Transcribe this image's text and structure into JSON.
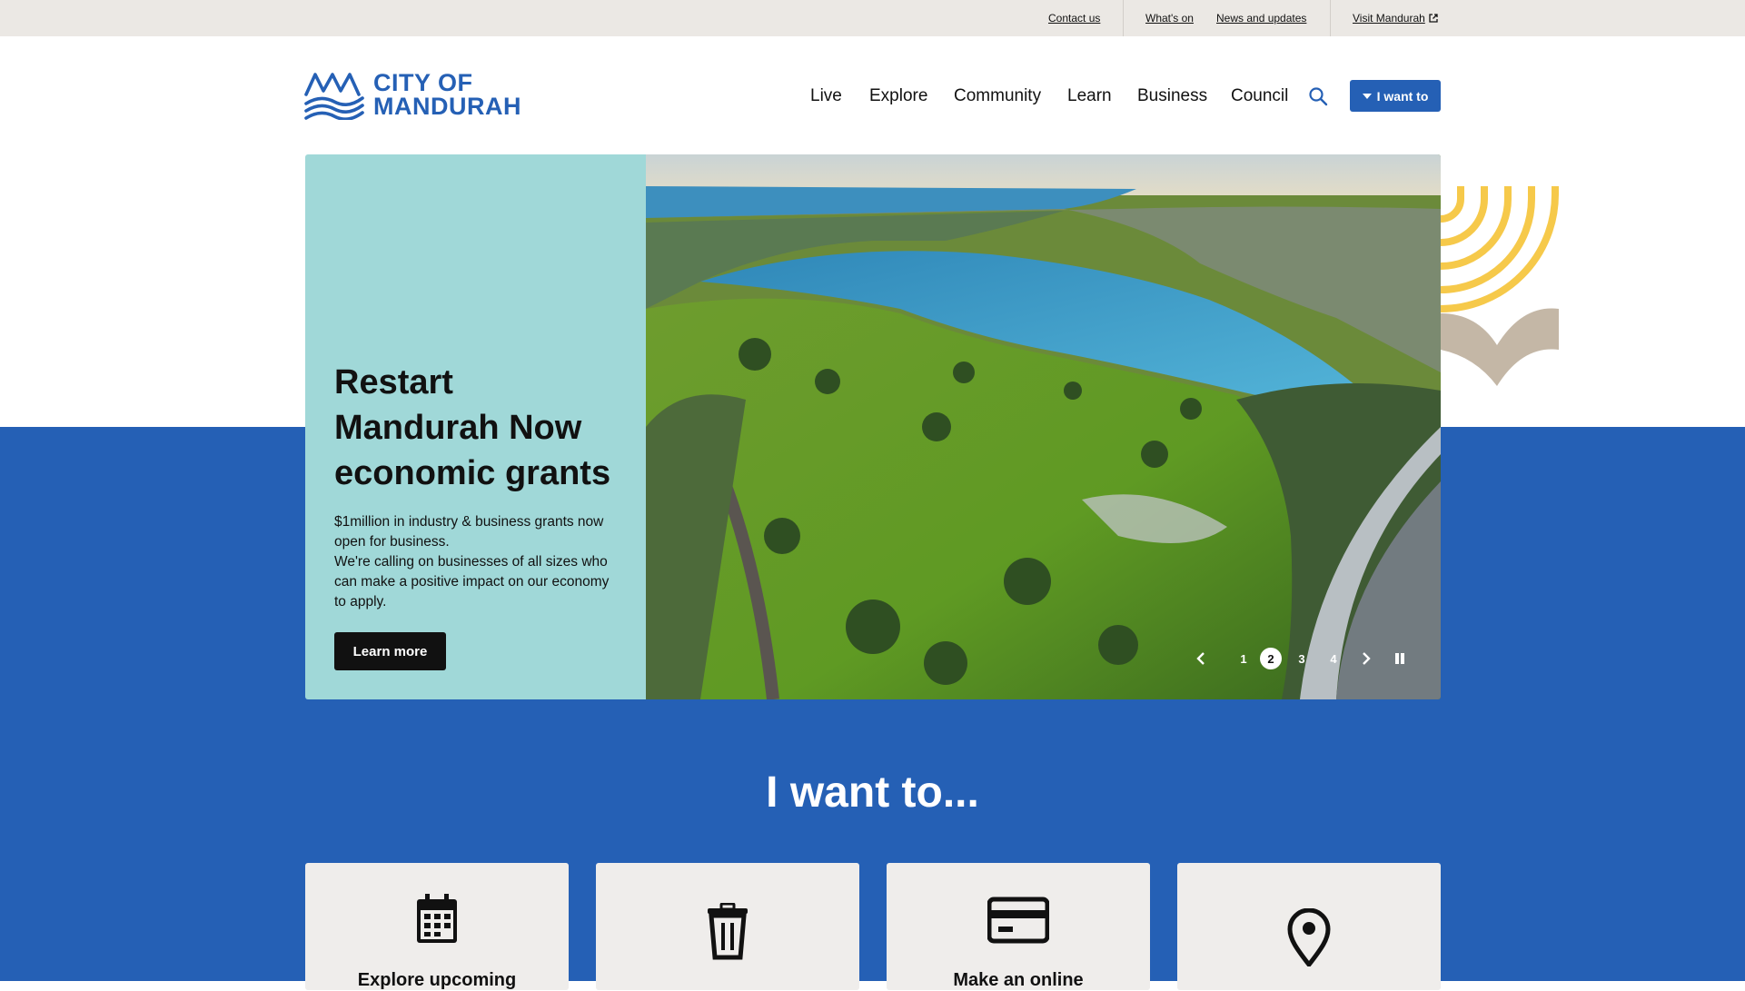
{
  "utility_nav": {
    "contact": "Contact us",
    "whats_on": "What's on",
    "news": "News and updates",
    "visit": "Visit Mandurah"
  },
  "logo": {
    "line1": "CITY OF",
    "line2": "MANDURAH"
  },
  "main_nav": {
    "items": [
      "Live",
      "Explore",
      "Community",
      "Learn",
      "Business",
      "Council"
    ],
    "i_want_to": "I want to"
  },
  "hero": {
    "title": "Restart Mandurah Now economic grants",
    "body_line1": "$1million in industry & business grants now open for business.",
    "body_line2": "We're calling on businesses of all sizes who can make a positive impact on our economy to apply.",
    "cta": "Learn more",
    "slides": [
      "1",
      "2",
      "3",
      "4"
    ],
    "active_slide": 2
  },
  "i_want_section": {
    "title": "I want to...",
    "cards": [
      {
        "label": "Explore upcoming",
        "icon": "calendar-icon"
      },
      {
        "label": "",
        "icon": "trash-bin-icon"
      },
      {
        "label": "Make an online",
        "icon": "credit-card-icon"
      },
      {
        "label": "",
        "icon": "map-pin-icon"
      }
    ]
  },
  "colors": {
    "brand_blue": "#2560b5",
    "utility_bg": "#ebe8e4",
    "hero_panel": "#a0d8d8",
    "deco_yellow": "#f6c94a",
    "deco_tan": "#c4b7a6",
    "card_bg": "#efedeb"
  }
}
